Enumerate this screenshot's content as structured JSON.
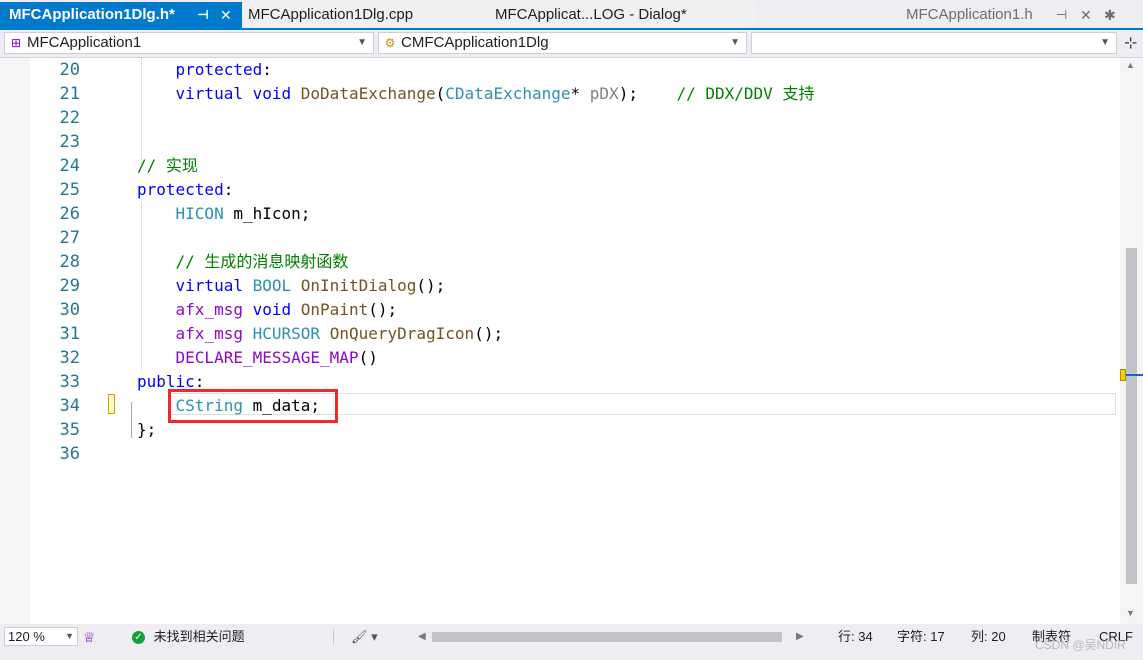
{
  "tabs": [
    {
      "label": "MFCApplication1Dlg.h*",
      "state": "active"
    },
    {
      "label": "MFCApplication1Dlg.cpp",
      "state": "inactive"
    },
    {
      "label": "MFCApplicat...LOG - Dialog*",
      "state": "inactive"
    },
    {
      "label": "MFCApplication1.h",
      "state": "preview"
    }
  ],
  "tab_icons": {
    "pin": "⊣",
    "close": "✕",
    "settings": "✱"
  },
  "navbar": {
    "project": "MFCApplication1",
    "class_scope": "CMFCApplication1Dlg",
    "member_scope": ""
  },
  "lines": [
    {
      "n": "20",
      "tokens": [
        [
          "    ",
          ""
        ],
        [
          "protected",
          "kw"
        ],
        [
          ":",
          ""
        ]
      ]
    },
    {
      "n": "21",
      "tokens": [
        [
          "    ",
          ""
        ],
        [
          "virtual",
          "kw"
        ],
        [
          " ",
          ""
        ],
        [
          "void",
          "kw"
        ],
        [
          " ",
          ""
        ],
        [
          "DoDataExchange",
          "fn"
        ],
        [
          "(",
          ""
        ],
        [
          "CDataExchange",
          "ty"
        ],
        [
          "* ",
          ""
        ],
        [
          "pDX",
          "pm"
        ],
        [
          ");    ",
          ""
        ],
        [
          "// DDX/DDV 支持",
          "cm"
        ]
      ]
    },
    {
      "n": "22",
      "tokens": []
    },
    {
      "n": "23",
      "tokens": []
    },
    {
      "n": "24",
      "tokens": [
        [
          "// 实现",
          "cm"
        ]
      ]
    },
    {
      "n": "25",
      "tokens": [
        [
          "protected",
          "kw"
        ],
        [
          ":",
          ""
        ]
      ]
    },
    {
      "n": "26",
      "tokens": [
        [
          "    ",
          ""
        ],
        [
          "HICON",
          "ty"
        ],
        [
          " m_hIcon;",
          ""
        ]
      ]
    },
    {
      "n": "27",
      "tokens": []
    },
    {
      "n": "28",
      "tokens": [
        [
          "    ",
          ""
        ],
        [
          "// 生成的消息映射函数",
          "cm"
        ]
      ]
    },
    {
      "n": "29",
      "tokens": [
        [
          "    ",
          ""
        ],
        [
          "virtual",
          "kw"
        ],
        [
          " ",
          ""
        ],
        [
          "BOOL",
          "ty"
        ],
        [
          " ",
          ""
        ],
        [
          "OnInitDialog",
          "fn"
        ],
        [
          "();",
          ""
        ]
      ]
    },
    {
      "n": "30",
      "tokens": [
        [
          "    ",
          ""
        ],
        [
          "afx_msg",
          "mac"
        ],
        [
          " ",
          ""
        ],
        [
          "void",
          "kw"
        ],
        [
          " ",
          ""
        ],
        [
          "OnPaint",
          "fn"
        ],
        [
          "();",
          ""
        ]
      ]
    },
    {
      "n": "31",
      "tokens": [
        [
          "    ",
          ""
        ],
        [
          "afx_msg",
          "mac"
        ],
        [
          " ",
          ""
        ],
        [
          "HCURSOR",
          "ty"
        ],
        [
          " ",
          ""
        ],
        [
          "OnQueryDragIcon",
          "fn"
        ],
        [
          "();",
          ""
        ]
      ]
    },
    {
      "n": "32",
      "tokens": [
        [
          "    ",
          ""
        ],
        [
          "DECLARE_MESSAGE_MAP",
          "mac"
        ],
        [
          "()",
          ""
        ]
      ]
    },
    {
      "n": "33",
      "tokens": [
        [
          "public",
          "kw"
        ],
        [
          ":",
          ""
        ]
      ]
    },
    {
      "n": "34",
      "tokens": [
        [
          "    ",
          ""
        ],
        [
          "CString",
          "ty"
        ],
        [
          " m_data;",
          ""
        ]
      ]
    },
    {
      "n": "35",
      "tokens": [
        [
          "};",
          ""
        ]
      ]
    },
    {
      "n": "36",
      "tokens": []
    }
  ],
  "status": {
    "zoom": "120 %",
    "issues": "未找到相关问题",
    "line": "行: 34",
    "char": "字符: 17",
    "col": "列: 20",
    "tabs": "制表符",
    "eol": "CRLF"
  },
  "watermark": "CSDN @吴NDIR",
  "colors": {
    "accent": "#007acc",
    "keyword": "#0000ff",
    "type": "#2b91af",
    "comment": "#008000",
    "macro": "#8f08c4",
    "highlight_box": "#ee2a2a"
  }
}
